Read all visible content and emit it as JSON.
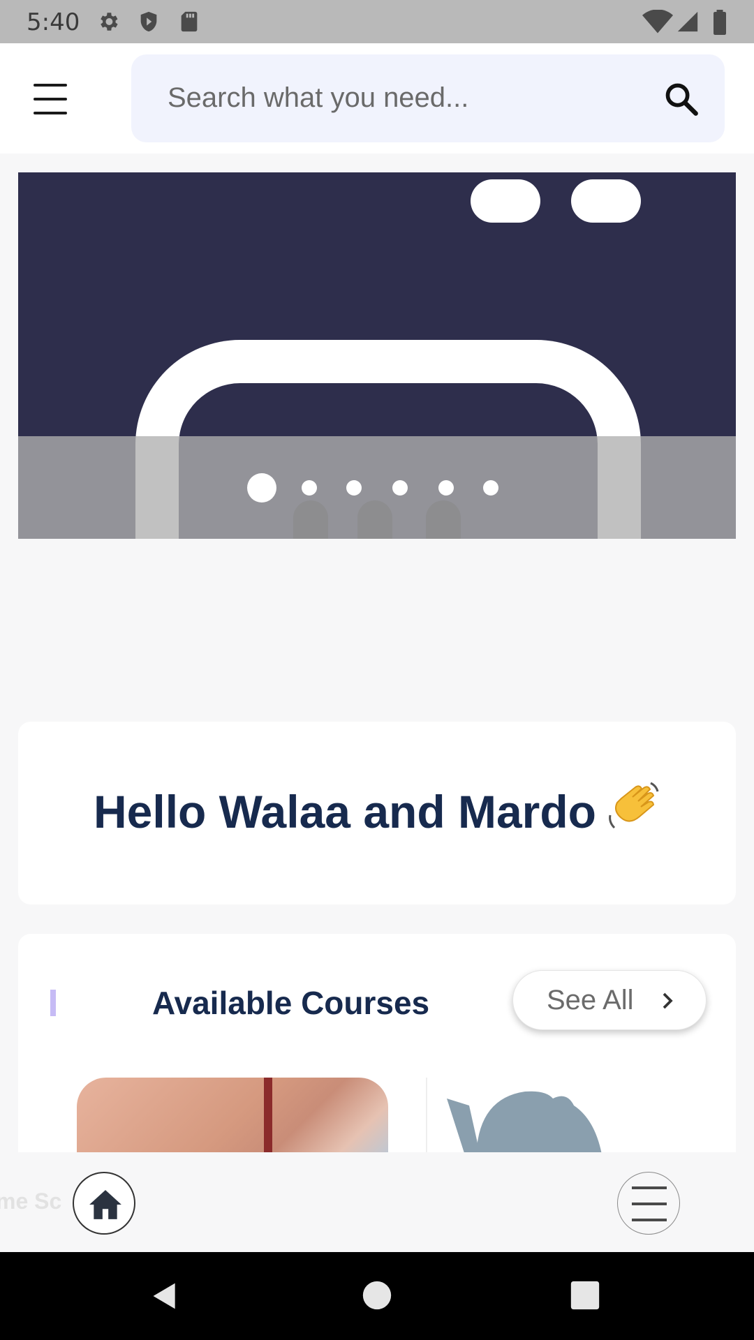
{
  "status_bar": {
    "time": "5:40",
    "icons_left": [
      "settings-icon",
      "shield-icon",
      "sd-card-icon"
    ],
    "icons_right": [
      "wifi-icon",
      "signal-icon",
      "battery-icon"
    ]
  },
  "top_bar": {
    "menu_icon": "hamburger-menu-icon",
    "search": {
      "placeholder": "Search what you need...",
      "value": "",
      "icon": "search-icon"
    }
  },
  "banner": {
    "slide_count": 6,
    "active_index": 0
  },
  "greeting": {
    "text": "Hello Walaa and Mardo",
    "emoji": "waving-hand-icon"
  },
  "courses": {
    "title": "Available Courses",
    "see_all_label": "See All"
  },
  "bottom_nav": {
    "partial_label": "me Sc",
    "home_icon": "home-icon",
    "more_icon": "menu-lines-icon"
  },
  "colors": {
    "heading": "#172a4e",
    "search_bg": "#f1f3fd",
    "accent": "#c6bbf5",
    "banner_bg": "#2e2e4c"
  }
}
